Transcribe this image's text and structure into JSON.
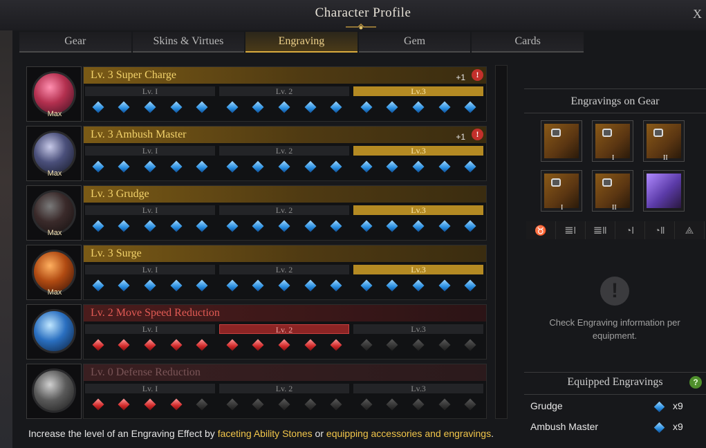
{
  "window": {
    "title": "Character Profile",
    "close_label": "X"
  },
  "tabs": [
    {
      "label": "Gear",
      "active": false
    },
    {
      "label": "Skins & Virtues",
      "active": false
    },
    {
      "label": "Engraving",
      "active": true
    },
    {
      "label": "Gem",
      "active": false
    },
    {
      "label": "Cards",
      "active": false
    }
  ],
  "engravings": [
    {
      "title": "Lv. 3 Super Charge",
      "style": "gold",
      "badge": "Max",
      "bonus": "+1",
      "warning": "!",
      "levels": [
        "Lv. I",
        "Lv. 2",
        "Lv.3"
      ],
      "active_level": 3,
      "filled": 15,
      "gem_color": "blue"
    },
    {
      "title": "Lv. 3 Ambush Master",
      "style": "gold",
      "badge": "Max",
      "bonus": "+1",
      "warning": "!",
      "levels": [
        "Lv. I",
        "Lv. 2",
        "Lv.3"
      ],
      "active_level": 3,
      "filled": 15,
      "gem_color": "blue"
    },
    {
      "title": "Lv. 3 Grudge",
      "style": "gold",
      "badge": "Max",
      "bonus": "",
      "warning": "",
      "levels": [
        "Lv. I",
        "Lv. 2",
        "Lv.3"
      ],
      "active_level": 3,
      "filled": 15,
      "gem_color": "blue"
    },
    {
      "title": "Lv. 3 Surge",
      "style": "gold",
      "badge": "Max",
      "bonus": "",
      "warning": "",
      "levels": [
        "Lv. I",
        "Lv. 2",
        "Lv.3"
      ],
      "active_level": 3,
      "filled": 15,
      "gem_color": "blue"
    },
    {
      "title": "Lv. 2 Move Speed Reduction",
      "style": "red",
      "badge": "",
      "bonus": "",
      "warning": "",
      "levels": [
        "Lv. I",
        "Lv. 2",
        "Lv.3"
      ],
      "active_level": 2,
      "filled": 10,
      "gem_color": "red"
    },
    {
      "title": "Lv. 0 Defense Reduction",
      "style": "dim",
      "badge": "",
      "bonus": "",
      "warning": "",
      "levels": [
        "Lv. I",
        "Lv. 2",
        "Lv.3"
      ],
      "active_level": 0,
      "filled": 4,
      "gem_color": "red"
    }
  ],
  "footer": {
    "prefix": "Increase the level of an Engraving Effect by ",
    "link1": "faceting Ability Stones",
    "middle": " or ",
    "link2": "equipping accessories and engravings",
    "suffix": "."
  },
  "gear_panel": {
    "title": "Engravings on Gear",
    "slots": [
      {
        "name": "necklace",
        "roman": ""
      },
      {
        "name": "earring",
        "roman": "I"
      },
      {
        "name": "earring",
        "roman": "II"
      },
      {
        "name": "ring",
        "roman": "I"
      },
      {
        "name": "ring",
        "roman": "II"
      },
      {
        "name": "ability-stone",
        "roman": ""
      }
    ],
    "categories": [
      "necklace-icon",
      "earring-1-icon",
      "earring-2-icon",
      "ring-1-icon",
      "ring-2-icon",
      "ability-stone-icon"
    ],
    "category_glyphs": [
      "♉",
      "𝌆Ⅰ",
      "𝌆Ⅱ",
      "◔Ⅰ",
      "◔Ⅱ",
      "⟁"
    ],
    "info_glyph": "!",
    "info_text": "Check Engraving information per equipment."
  },
  "equipped": {
    "title": "Equipped Engravings",
    "help_label": "?",
    "items": [
      {
        "name": "Grudge",
        "count": "x9"
      },
      {
        "name": "Ambush Master",
        "count": "x9"
      }
    ]
  },
  "colors": {
    "accent_gold": "#d9ab3e",
    "danger_red": "#c3302b",
    "help_green": "#4f8f2c"
  }
}
